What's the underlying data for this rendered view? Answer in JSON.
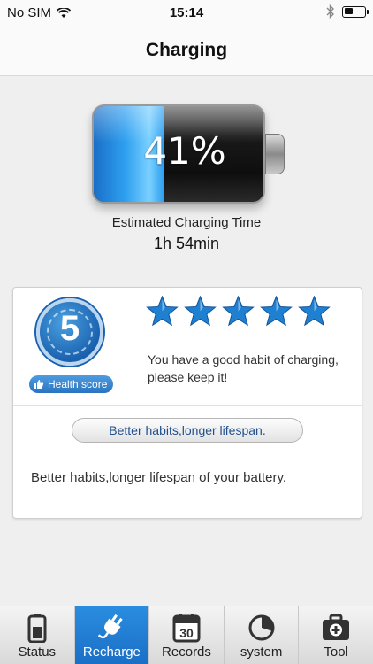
{
  "status_bar": {
    "carrier": "No SIM",
    "time": "15:14"
  },
  "nav": {
    "title": "Charging"
  },
  "battery": {
    "percent_text": "41%",
    "level": 0.41,
    "fill_color": "#2e9ff0"
  },
  "estimate": {
    "label": "Estimated Charging Time",
    "value": "1h 54min"
  },
  "health": {
    "score": "5",
    "badge_label": "Health score",
    "stars": 5,
    "star_color": "#1f7fd0",
    "message": "You have a good habit of charging, please keep it!",
    "button_label": "Better habits,longer lifespan.",
    "footer": "Better habits,longer lifespan of your battery."
  },
  "tabs": [
    {
      "label": "Status",
      "icon": "battery-icon",
      "active": false
    },
    {
      "label": "Recharge",
      "icon": "plug-icon",
      "active": true
    },
    {
      "label": "Records",
      "icon": "calendar-icon",
      "calendar_day": "30",
      "active": false
    },
    {
      "label": "system",
      "icon": "pie-chart-icon",
      "active": false
    },
    {
      "label": "Tool",
      "icon": "toolbox-icon",
      "active": false
    }
  ]
}
